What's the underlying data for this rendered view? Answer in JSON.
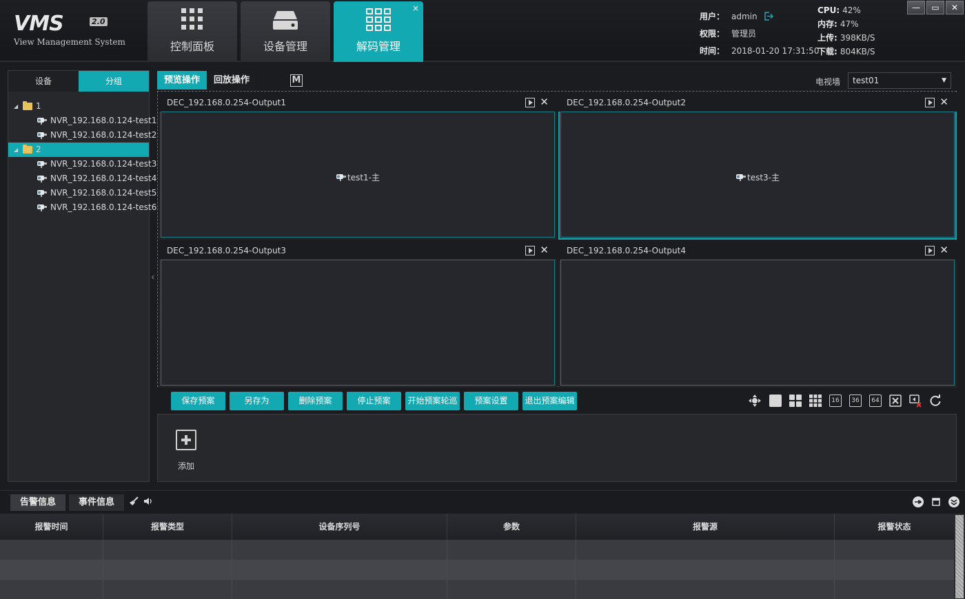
{
  "logo": {
    "main": "VMS",
    "version": "2.0",
    "subtitle": "View Management System"
  },
  "nav": {
    "tabs": [
      {
        "label": "控制面板",
        "icon": "grid-dots-icon"
      },
      {
        "label": "设备管理",
        "icon": "device-drive-icon"
      },
      {
        "label": "解码管理",
        "icon": "grid-squares-icon",
        "close": "×"
      }
    ]
  },
  "user_info": {
    "user_key": "用户：",
    "user": "admin",
    "role_key": "权限：",
    "role": "管理员",
    "time_key": "时间：",
    "time": "2018-01-20 17:31:50"
  },
  "stats": {
    "cpu_key": "CPU:",
    "cpu": "42%",
    "mem_key": "内存:",
    "mem": "47%",
    "up_key": "上传:",
    "up": "398KB/S",
    "down_key": "下载:",
    "down": "804KB/S"
  },
  "window_controls": {
    "minimize": "—",
    "restore": "▭",
    "close": "✕"
  },
  "left": {
    "tabs": [
      "设备",
      "分组"
    ],
    "tree": [
      {
        "label": "1",
        "type": "group",
        "children": [
          "NVR_192.168.0.124-test1",
          "NVR_192.168.0.124-test2"
        ]
      },
      {
        "label": "2",
        "type": "group",
        "children": [
          "NVR_192.168.0.124-test3",
          "NVR_192.168.0.124-test4",
          "NVR_192.168.0.124-test5",
          "NVR_192.168.0.124-test6"
        ]
      }
    ]
  },
  "main_tabs": [
    "预览操作",
    "回放操作"
  ],
  "m_box": "M",
  "tv_wall": {
    "label": "电视墙",
    "value": "test01"
  },
  "outputs": [
    {
      "title": "DEC_192.168.0.254-Output1",
      "content": "test1-主"
    },
    {
      "title": "DEC_192.168.0.254-Output2",
      "content": "test3-主"
    },
    {
      "title": "DEC_192.168.0.254-Output3",
      "content": ""
    },
    {
      "title": "DEC_192.168.0.254-Output4",
      "content": ""
    }
  ],
  "actions": [
    "保存预案",
    "另存为",
    "删除预案",
    "停止预案",
    "开始预案轮巡",
    "预案设置",
    "退出预案编辑"
  ],
  "layout_icons": {
    "l16": "16",
    "l36": "36",
    "l64": "64"
  },
  "add_panel": {
    "label": "添加"
  },
  "bottom": {
    "tabs": [
      "告警信息",
      "事件信息"
    ],
    "columns": [
      "报警时间",
      "报警类型",
      "设备序列号",
      "参数",
      "报警源",
      "报警状态"
    ]
  }
}
